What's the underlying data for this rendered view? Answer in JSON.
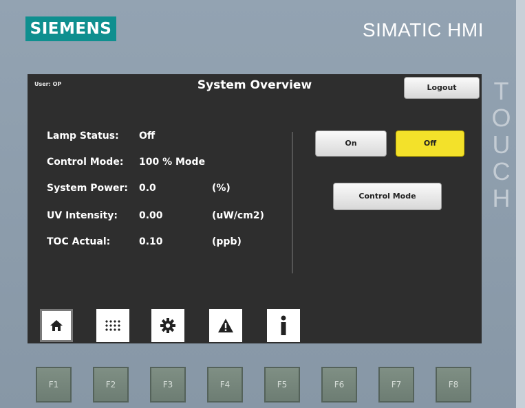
{
  "device": {
    "brand": "SIEMENS",
    "model": "SIMATIC HMI",
    "touch_label": "TOUCH"
  },
  "screen": {
    "user": "User: OP",
    "title": "System Overview",
    "logout_label": "Logout"
  },
  "status": [
    {
      "label": "Lamp Status:",
      "value": "Off",
      "unit": ""
    },
    {
      "label": "Control Mode:",
      "value": "100 % Mode",
      "unit": ""
    },
    {
      "label": "System Power:",
      "value": "0.0",
      "unit": "(%)"
    },
    {
      "label": "UV Intensity:",
      "value": "0.00",
      "unit": "(uW/cm2)"
    },
    {
      "label": "TOC Actual:",
      "value": "0.10",
      "unit": "(ppb)"
    }
  ],
  "controls": {
    "on_label": "On",
    "off_label": "Off",
    "control_mode_label": "Control Mode",
    "active_color": "#f3e12a"
  },
  "nav": [
    {
      "icon": "home-icon"
    },
    {
      "icon": "grid-icon"
    },
    {
      "icon": "gear-icon"
    },
    {
      "icon": "warning-icon"
    },
    {
      "icon": "info-icon"
    }
  ],
  "function_keys": [
    "F1",
    "F2",
    "F3",
    "F4",
    "F5",
    "F6",
    "F7",
    "F8"
  ],
  "colors": {
    "brand": "#0f8f8f",
    "screen_bg": "#2e2e2e",
    "bezel": "#8a9aa9"
  }
}
